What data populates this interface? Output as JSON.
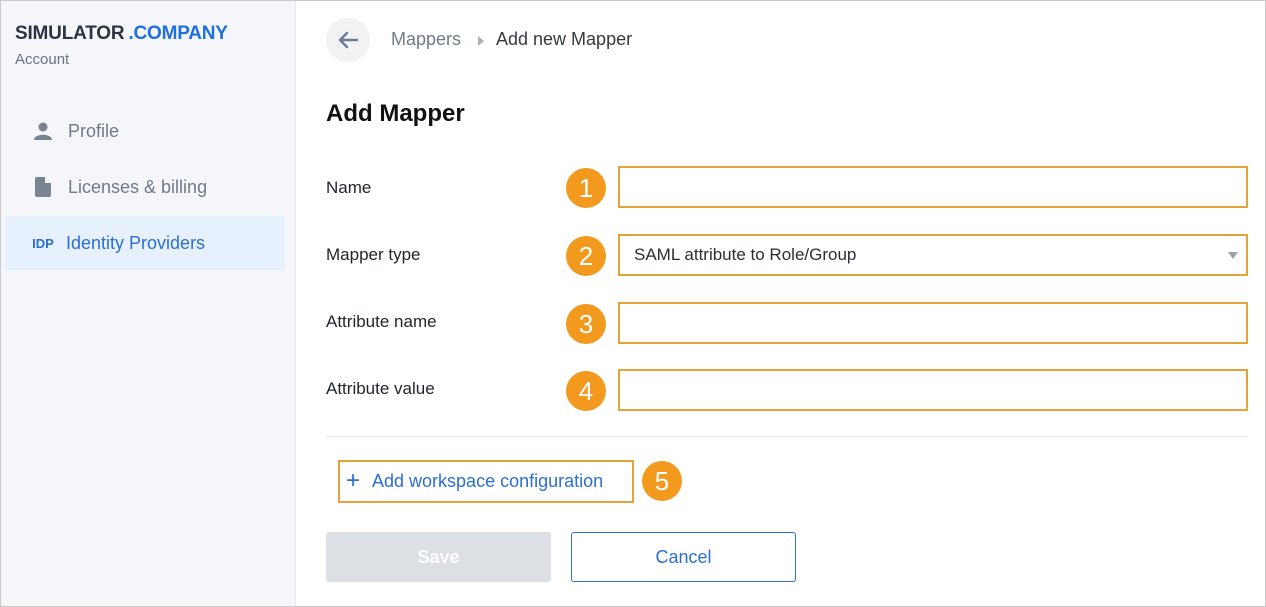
{
  "brand": {
    "name": "SIMULATOR",
    "suffix": ".COMPANY",
    "subtitle": "Account"
  },
  "sidebar": {
    "items": [
      {
        "label": "Profile",
        "icon": "user-icon",
        "active": false
      },
      {
        "label": "Licenses & billing",
        "icon": "document-icon",
        "active": false
      },
      {
        "label": "Identity Providers",
        "icon": "idp-icon",
        "icon_text": "IDP",
        "active": true
      }
    ]
  },
  "breadcrumb": {
    "parent": "Mappers",
    "current": "Add new Mapper"
  },
  "page": {
    "title": "Add Mapper"
  },
  "form": {
    "fields": [
      {
        "label": "Name",
        "badge": "1",
        "type": "text",
        "value": ""
      },
      {
        "label": "Mapper type",
        "badge": "2",
        "type": "select",
        "value": "SAML attribute to Role/Group"
      },
      {
        "label": "Attribute name",
        "badge": "3",
        "type": "text",
        "value": ""
      },
      {
        "label": "Attribute value",
        "badge": "4",
        "type": "text",
        "value": ""
      }
    ],
    "add_workspace": {
      "label": "Add workspace configuration",
      "badge": "5"
    },
    "save_label": "Save",
    "cancel_label": "Cancel"
  },
  "colors": {
    "accent": "#2b6ed6",
    "highlight": "#e3a33a",
    "badge": "#f39a1e"
  }
}
